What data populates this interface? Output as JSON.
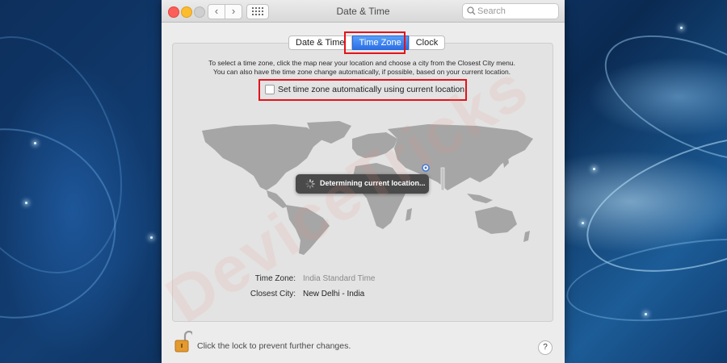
{
  "window": {
    "title": "Date & Time"
  },
  "toolbar": {
    "back_glyph": "‹",
    "forward_glyph": "›"
  },
  "search": {
    "placeholder": "Search"
  },
  "tabs": [
    {
      "label": "Date & Time",
      "active": false
    },
    {
      "label": "Time Zone",
      "active": true
    },
    {
      "label": "Clock",
      "active": false
    }
  ],
  "instructions": {
    "line1": "To select a time zone, click the map near your location and choose a city from the Closest City menu.",
    "line2": "You can also have the time zone change automatically, if possible, based on your current location."
  },
  "auto_timezone": {
    "label": "Set time zone automatically using current location",
    "checked": false
  },
  "map": {
    "status": "Determining current location..."
  },
  "time_zone": {
    "label": "Time Zone:",
    "value": "India Standard Time"
  },
  "closest_city": {
    "label": "Closest City:",
    "value": "New Delhi - India"
  },
  "footer": {
    "lock_text": "Click the lock to prevent further changes.",
    "help_glyph": "?"
  },
  "watermark": "DeviceTricks",
  "colors": {
    "highlight": "#e4121a",
    "tab_active": "#2a6fe6",
    "map_land": "#a6a6a6"
  }
}
